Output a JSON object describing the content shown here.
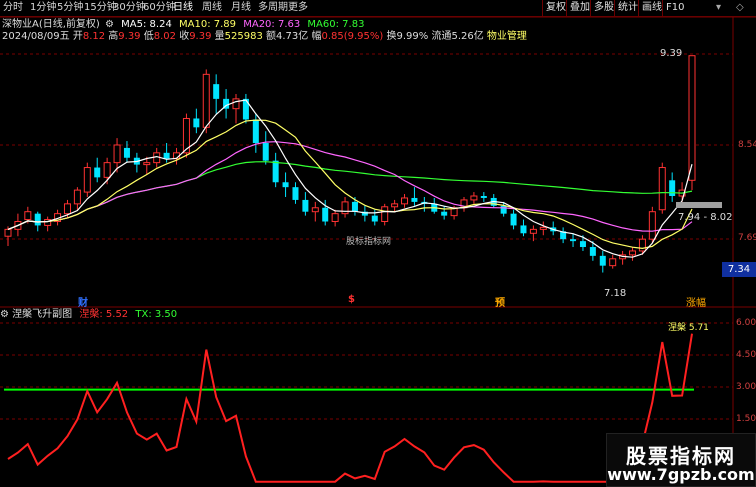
{
  "toolbar": {
    "timeframes": [
      "分时",
      "1分钟",
      "5分钟",
      "15分钟",
      "30分钟",
      "60分钟",
      "日线",
      "周线",
      "月线",
      "多周期",
      "更多"
    ],
    "active": "日线",
    "right_buttons": [
      "复权",
      "叠加",
      "多股",
      "统计",
      "画线",
      "F10"
    ]
  },
  "header": {
    "stock_name": "深物业A(日线,前复权)",
    "ma5_label": "MA5: 8.24",
    "ma10_label": "MA10: 7.89",
    "ma20_label": "MA20: 7.63",
    "ma60_label": "MA60: 7.83",
    "date": "2024/08/09五",
    "open_label": "开",
    "open": "8.12",
    "high_label": "高",
    "high": "9.39",
    "low_label": "低",
    "low": "8.02",
    "close_label": "收",
    "close": "9.39",
    "volume_label": "量",
    "volume": "525983",
    "amount_label": "额",
    "amount": "4.73亿",
    "change_label": "幅",
    "change": "0.85(9.95%)",
    "turnover_label": "换",
    "turnover": "9.99%",
    "float_label": "流通",
    "float": "5.26亿",
    "industry": "物业管理"
  },
  "colors": {
    "up": "#ff3232",
    "down": "#00e5ff",
    "ma5": "#ffffff",
    "ma10": "#ffff66",
    "ma20": "#ff66ff",
    "ma60": "#33ff33",
    "grid": "#7a0000",
    "green_line": "#00ff00",
    "red_line": "#ff2020"
  },
  "price_axis": [
    "9.39",
    "8.54",
    "7.69"
  ],
  "current_price_tag": "7.34",
  "annotations": {
    "high": "9.39",
    "low": "7.18",
    "range": "7.94 - 8.02"
  },
  "bottom_tags": {
    "tag1": "财",
    "tag2": "$",
    "tag3": "预",
    "tag4": "涨幅"
  },
  "watermark": "股标指标网",
  "sub_chart": {
    "title": "涅槃飞升副图",
    "line1_label": "涅槃",
    "line1_value": "5.52",
    "line2_label": "TX",
    "line2_value": "3.50",
    "axis": [
      "6.00",
      "4.50",
      "3.00",
      "1.50",
      "0.00"
    ],
    "annotation": "涅槃 5.71"
  },
  "logo": {
    "line1": "股票指标网",
    "line2": "www.7gpzb.com"
  },
  "chart_data": {
    "type": "candlestick",
    "price_range": [
      6.9,
      9.55
    ],
    "candles": [
      [
        7.55,
        7.65,
        7.45,
        7.62
      ],
      [
        7.62,
        7.78,
        7.55,
        7.7
      ],
      [
        7.72,
        7.85,
        7.68,
        7.8
      ],
      [
        7.78,
        7.8,
        7.6,
        7.66
      ],
      [
        7.66,
        7.75,
        7.6,
        7.72
      ],
      [
        7.7,
        7.82,
        7.66,
        7.78
      ],
      [
        7.78,
        7.92,
        7.74,
        7.88
      ],
      [
        7.88,
        8.05,
        7.82,
        8.02
      ],
      [
        8.0,
        8.3,
        7.95,
        8.25
      ],
      [
        8.25,
        8.35,
        8.1,
        8.15
      ],
      [
        8.15,
        8.35,
        8.08,
        8.3
      ],
      [
        8.3,
        8.55,
        8.2,
        8.48
      ],
      [
        8.45,
        8.52,
        8.3,
        8.35
      ],
      [
        8.35,
        8.4,
        8.2,
        8.28
      ],
      [
        8.28,
        8.36,
        8.18,
        8.3
      ],
      [
        8.3,
        8.45,
        8.25,
        8.4
      ],
      [
        8.4,
        8.5,
        8.3,
        8.34
      ],
      [
        8.34,
        8.45,
        8.28,
        8.4
      ],
      [
        8.4,
        8.8,
        8.35,
        8.75
      ],
      [
        8.75,
        8.85,
        8.6,
        8.66
      ],
      [
        8.66,
        9.25,
        8.6,
        9.2
      ],
      [
        9.1,
        9.2,
        8.8,
        8.95
      ],
      [
        8.95,
        9.05,
        8.75,
        8.85
      ],
      [
        8.85,
        9.0,
        8.7,
        8.95
      ],
      [
        8.95,
        9.0,
        8.7,
        8.74
      ],
      [
        8.74,
        8.8,
        8.4,
        8.5
      ],
      [
        8.5,
        8.62,
        8.28,
        8.32
      ],
      [
        8.32,
        8.4,
        8.05,
        8.1
      ],
      [
        8.1,
        8.2,
        7.95,
        8.05
      ],
      [
        8.05,
        8.1,
        7.88,
        7.92
      ],
      [
        7.92,
        8.0,
        7.76,
        7.8
      ],
      [
        7.8,
        7.9,
        7.7,
        7.84
      ],
      [
        7.84,
        7.92,
        7.66,
        7.7
      ],
      [
        7.7,
        7.82,
        7.65,
        7.78
      ],
      [
        7.78,
        7.95,
        7.74,
        7.9
      ],
      [
        7.9,
        7.95,
        7.76,
        7.8
      ],
      [
        7.8,
        7.86,
        7.7,
        7.76
      ],
      [
        7.76,
        7.82,
        7.66,
        7.7
      ],
      [
        7.7,
        7.88,
        7.66,
        7.85
      ],
      [
        7.85,
        7.92,
        7.8,
        7.88
      ],
      [
        7.88,
        7.98,
        7.84,
        7.94
      ],
      [
        7.94,
        8.05,
        7.86,
        7.9
      ],
      [
        7.9,
        7.95,
        7.8,
        7.88
      ],
      [
        7.88,
        7.94,
        7.78,
        7.8
      ],
      [
        7.8,
        7.86,
        7.72,
        7.76
      ],
      [
        7.76,
        7.86,
        7.72,
        7.84
      ],
      [
        7.84,
        7.95,
        7.8,
        7.92
      ],
      [
        7.92,
        8.0,
        7.88,
        7.96
      ],
      [
        7.96,
        8.0,
        7.9,
        7.94
      ],
      [
        7.94,
        7.98,
        7.84,
        7.86
      ],
      [
        7.86,
        7.9,
        7.75,
        7.78
      ],
      [
        7.78,
        7.82,
        7.62,
        7.66
      ],
      [
        7.66,
        7.72,
        7.55,
        7.58
      ],
      [
        7.58,
        7.66,
        7.5,
        7.62
      ],
      [
        7.62,
        7.7,
        7.56,
        7.64
      ],
      [
        7.64,
        7.7,
        7.56,
        7.6
      ],
      [
        7.6,
        7.64,
        7.48,
        7.52
      ],
      [
        7.52,
        7.58,
        7.44,
        7.5
      ],
      [
        7.5,
        7.56,
        7.4,
        7.44
      ],
      [
        7.44,
        7.5,
        7.3,
        7.35
      ],
      [
        7.35,
        7.4,
        7.18,
        7.25
      ],
      [
        7.25,
        7.36,
        7.22,
        7.32
      ],
      [
        7.32,
        7.4,
        7.26,
        7.36
      ],
      [
        7.36,
        7.44,
        7.3,
        7.4
      ],
      [
        7.4,
        7.56,
        7.36,
        7.52
      ],
      [
        7.52,
        7.85,
        7.48,
        7.8
      ],
      [
        7.82,
        8.3,
        7.78,
        8.25
      ],
      [
        8.12,
        8.2,
        7.9,
        7.96
      ],
      [
        7.96,
        8.1,
        7.9,
        8.02
      ],
      [
        8.12,
        9.39,
        8.02,
        9.39
      ]
    ]
  }
}
